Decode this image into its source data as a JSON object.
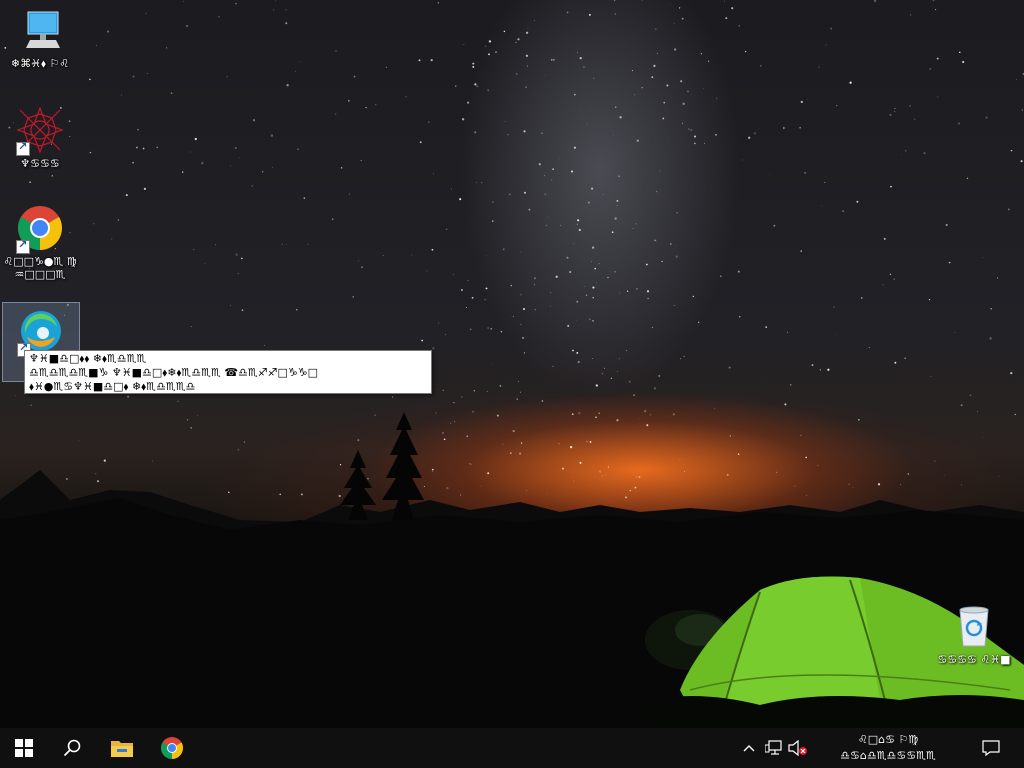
{
  "desktop": {
    "icons": [
      {
        "label": "❄⌘♓⬧ ⚐♌",
        "icon": "this-pc-icon"
      },
      {
        "label": "♆♋♋♋",
        "icon": "app-shortcut-icon"
      },
      {
        "label": "♌□□♑●♏ ♍♒□□□♏",
        "icon": "chrome-icon"
      },
      {
        "label": "⬧⬧",
        "icon": "edge-icon"
      },
      {
        "label": "♋♋♋♋ ♌♓■",
        "icon": "recycle-bin-icon"
      }
    ]
  },
  "tooltip": {
    "lines": [
      "♆♓■♎□⬧⬧ ❄⬧♏♎♏♏",
      "♎♏♎♏♎♏■♑ ♆♓■♎□⬧❄⬧♏♎♏♏ ☎♎♏♐♐□♑♑□",
      "⬧♓●♏♋♆♓■♎□⬧ ❄⬧♏♎♏♏♎"
    ]
  },
  "taskbar": {
    "start": "windows-start-icon",
    "search": "search-icon",
    "pinned": [
      "file-explorer-icon",
      "chrome-icon"
    ],
    "tray": [
      "chevron-up-icon",
      "network-icon",
      "volume-muted-icon",
      "action-center-icon"
    ],
    "clock": {
      "time": "♌□⌂♋ ⚐♍",
      "date": "♎♋⌂♎♏♎♋♋♏♏"
    }
  }
}
